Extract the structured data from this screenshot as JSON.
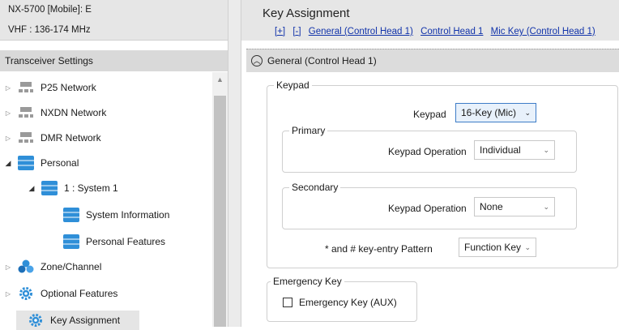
{
  "device": {
    "model_line": "NX-5700 [Mobile]: E",
    "band_line": "VHF : 136-174 MHz"
  },
  "tree": {
    "header": "Transceiver Settings",
    "items": [
      {
        "label": "P25 Network",
        "icon": "network-icon",
        "expander": "collapsed"
      },
      {
        "label": "NXDN Network",
        "icon": "network-icon",
        "expander": "collapsed"
      },
      {
        "label": "DMR Network",
        "icon": "network-icon",
        "expander": "collapsed"
      },
      {
        "label": "Personal",
        "icon": "stack-icon",
        "expander": "expanded"
      },
      {
        "label": "1 : System 1",
        "icon": "stack-icon",
        "expander": "expanded"
      },
      {
        "label": "System Information",
        "icon": "stack-icon",
        "expander": "none"
      },
      {
        "label": "Personal Features",
        "icon": "stack-icon",
        "expander": "none"
      },
      {
        "label": "Zone/Channel",
        "icon": "zone-channel-icon",
        "expander": "collapsed"
      },
      {
        "label": "Optional Features",
        "icon": "gear-icon",
        "expander": "collapsed"
      },
      {
        "label": "Key Assignment",
        "icon": "gear-icon",
        "expander": "none",
        "selected": true
      }
    ]
  },
  "main": {
    "title": "Key Assignment",
    "links": [
      "[+]",
      "[-]",
      "General (Control Head 1)",
      "Control Head 1",
      "Mic Key (Control Head 1)"
    ],
    "section_title": "General (Control Head 1)",
    "keypad_group": {
      "title": "Keypad",
      "keypad_label": "Keypad",
      "keypad_value": "16-Key (Mic)",
      "primary": {
        "title": "Primary",
        "operation_label": "Keypad Operation",
        "operation_value": "Individual"
      },
      "secondary": {
        "title": "Secondary",
        "operation_label": "Keypad Operation",
        "operation_value": "None"
      },
      "pattern_label": "* and # key-entry Pattern",
      "pattern_value": "Function Key"
    },
    "emergency_group": {
      "title": "Emergency Key",
      "checkbox_label": "Emergency Key (AUX)",
      "checked": false
    }
  },
  "colors": {
    "link": "#1133aa",
    "accent": "#3d7cc7",
    "icon_blue": "#2f8fd8"
  }
}
